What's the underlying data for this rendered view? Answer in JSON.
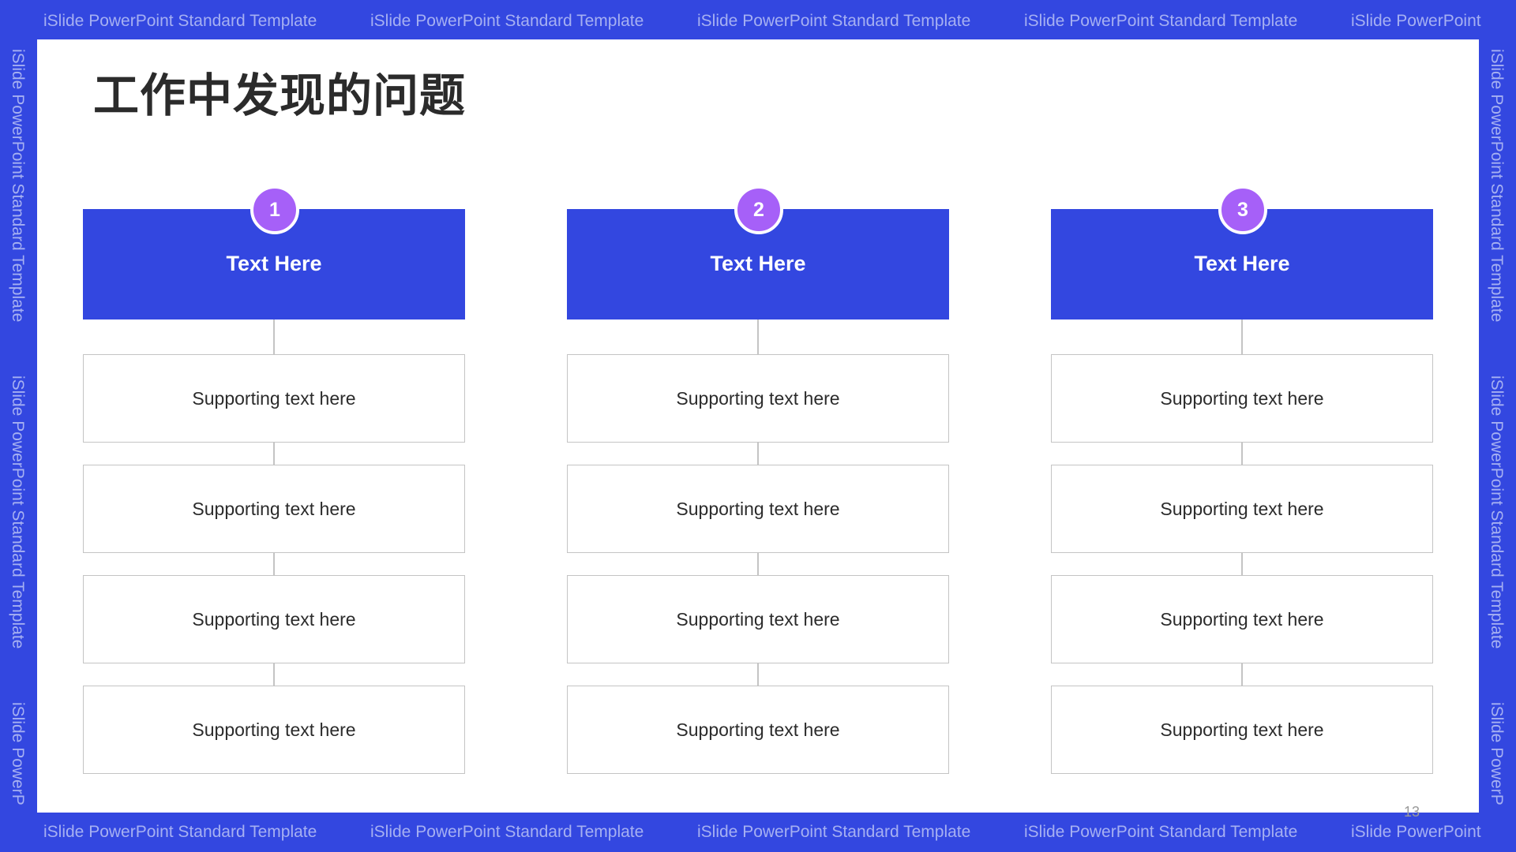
{
  "watermark": {
    "text": "iSlide PowerPoint Standard Template",
    "truncated_horizontal": "iSlide PowerPoint",
    "truncated_vertical": "iSlide PowerP"
  },
  "slide": {
    "title": "工作中发现的问题",
    "page_number": "13",
    "colors": {
      "frame": "#3347E0",
      "header_fill": "#3347E0",
      "badge_fill": "#A660F8",
      "box_border": "#C4C4C4",
      "text_dark": "#2B2B2B"
    },
    "columns": [
      {
        "number": "1",
        "heading": "Text Here",
        "items": [
          "Supporting text here",
          "Supporting text here",
          "Supporting text here",
          "Supporting text here"
        ]
      },
      {
        "number": "2",
        "heading": "Text Here",
        "items": [
          "Supporting text here",
          "Supporting text here",
          "Supporting text here",
          "Supporting text here"
        ]
      },
      {
        "number": "3",
        "heading": "Text Here",
        "items": [
          "Supporting text here",
          "Supporting text here",
          "Supporting text here",
          "Supporting text here"
        ]
      }
    ]
  }
}
